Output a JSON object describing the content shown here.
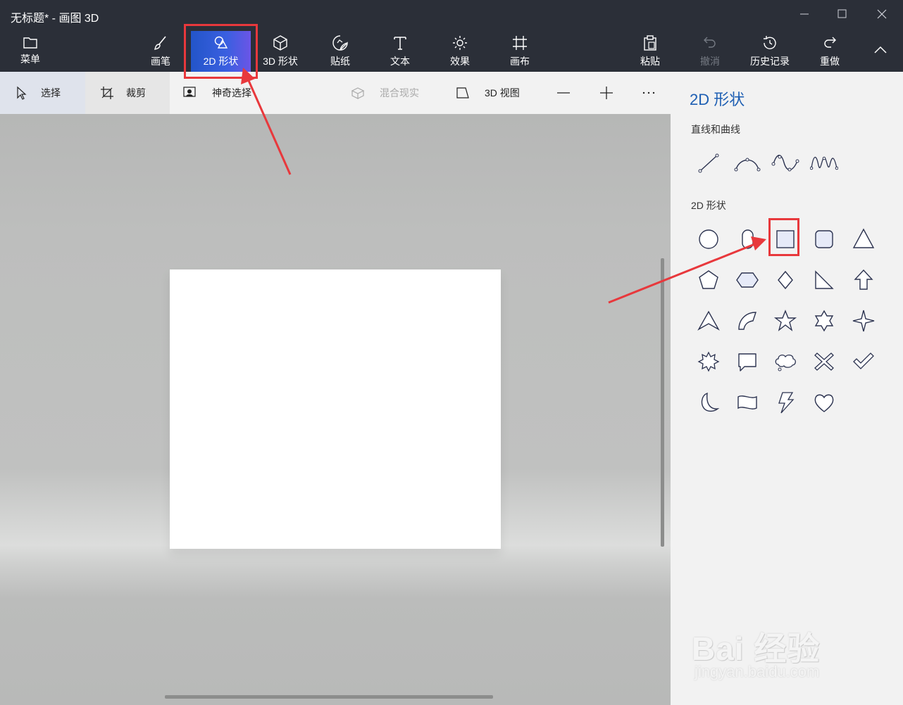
{
  "window": {
    "title": "无标题* - 画图 3D"
  },
  "ribbon": {
    "menu": "菜单",
    "brushes": "画笔",
    "shapes2d": "2D 形状",
    "shapes3d": "3D 形状",
    "stickers": "贴纸",
    "text": "文本",
    "effects": "效果",
    "canvas": "画布",
    "paste": "粘贴",
    "undo": "撤消",
    "history": "历史记录",
    "redo": "重做"
  },
  "toolbar": {
    "select": "选择",
    "crop": "裁剪",
    "magic_select": "神奇选择",
    "mixed_reality": "混合现实",
    "view3d": "3D 视图"
  },
  "panel": {
    "title": "2D 形状",
    "lines_heading": "直线和曲线",
    "shapes_heading": "2D 形状",
    "selected_shape": "rectangle",
    "accent_color": "#1e5fb3"
  },
  "colors": {
    "highlight": "#e8383c",
    "ribbon_bg": "#2b2f38",
    "active_tab": "#3a5fe0"
  },
  "watermark": {
    "line1": "Bai 经验",
    "line2": "jingyan.baidu.com"
  }
}
